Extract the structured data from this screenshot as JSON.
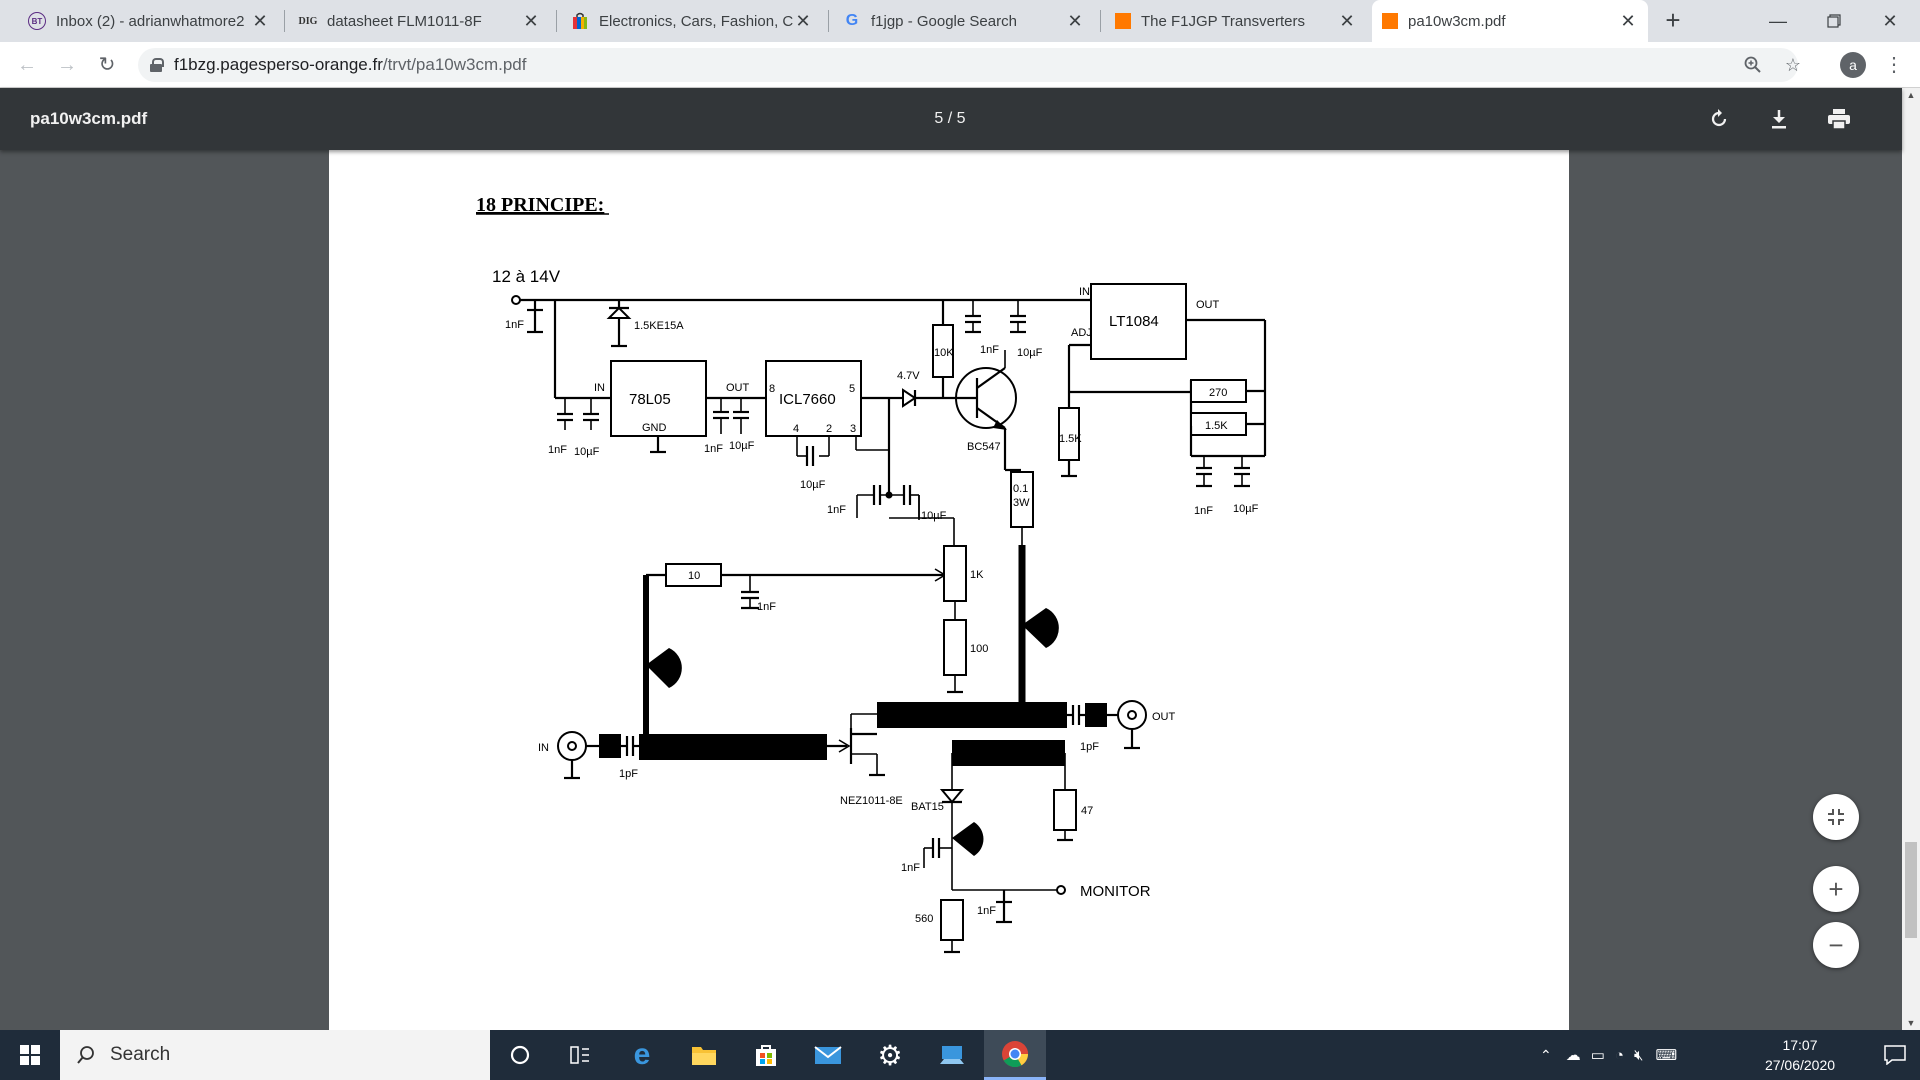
{
  "browser": {
    "tabs": [
      {
        "title": "Inbox (2) - adrianwhatmore2",
        "favicon": "bt-icon",
        "active": false
      },
      {
        "title": "datasheet FLM1011-8F",
        "favicon": "dig-icon",
        "active": false
      },
      {
        "title": "Electronics, Cars, Fashion, Co",
        "favicon": "ebay-bag-icon",
        "active": false
      },
      {
        "title": "f1jgp - Google Search",
        "favicon": "google-icon",
        "active": false
      },
      {
        "title": "The F1JGP Transverters",
        "favicon": "orange-icon",
        "active": false
      },
      {
        "title": "pa10w3cm.pdf",
        "favicon": "orange-icon",
        "active": true
      }
    ],
    "url_host": "f1bzg.pagesperso-orange.fr",
    "url_path": "/trvt/pa10w3cm.pdf",
    "avatar_letter": "a"
  },
  "pdf_viewer": {
    "filename": "pa10w3cm.pdf",
    "page_indicator": "5 / 5"
  },
  "schematic": {
    "heading": "18 PRINCIPE:",
    "supply_label": "12 à 14V",
    "parts": {
      "c_in1": "1nF",
      "tvs": "1.5KE15A",
      "reg_78": "78L05",
      "reg_in": "IN",
      "reg_out": "OUT",
      "reg_gnd": "GND",
      "c_1nf_a": "1nF",
      "c_10uf_a": "10µF",
      "c_1nf_b": "1nF",
      "c_10uf_b": "10µF",
      "icl": "ICL7660",
      "pin8": "8",
      "pin5": "5",
      "pin4": "4",
      "pin2": "2",
      "pin3": "3",
      "c_icl": "10µF",
      "zener": "4.7V",
      "r10k": "10K",
      "c_top_1nf": "1nF",
      "c_top_10uf": "10µF",
      "bc547": "BC547",
      "lt1084": "LT1084",
      "lt_in": "IN",
      "lt_out": "OUT",
      "lt_adj": "ADJ",
      "r1_5k_left": "1.5K",
      "r270": "270",
      "r1_5k": "1.5K",
      "c_out_1nf": "1nF",
      "c_out_10uf": "10µF",
      "c_neg_10uf_top": "10µF",
      "c_neg_1nf": "1nF",
      "c_neg_10uf": "10µF",
      "r_shunt": "0.1",
      "r_shunt_w": "3W",
      "r10": "10",
      "c_gate_1nf": "1nF",
      "pot1k": "1K",
      "r100": "100",
      "in_label": "IN",
      "out_label": "OUT",
      "c_in_1pf": "1pF",
      "c_out_1pf": "1pF",
      "fet": "NEZ1011-8E",
      "diode": "BAT15",
      "r47": "47",
      "c_det_1nf": "1nF",
      "r560": "560",
      "c_mon_1nf": "1nF",
      "monitor": "MONITOR"
    }
  },
  "taskbar": {
    "search_placeholder": "Search",
    "time": "17:07",
    "date": "27/06/2020"
  }
}
